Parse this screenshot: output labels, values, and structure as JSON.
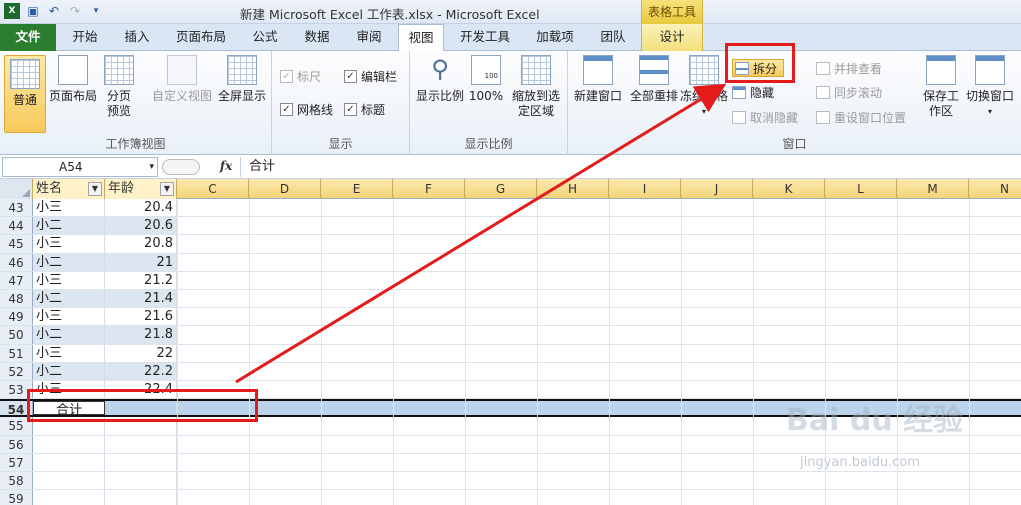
{
  "window": {
    "title": "新建 Microsoft Excel 工作表.xlsx - Microsoft Excel",
    "contextual_tab_group": "表格工具"
  },
  "tabs": [
    "文件",
    "开始",
    "插入",
    "页面布局",
    "公式",
    "数据",
    "审阅",
    "视图",
    "开发工具",
    "加载项",
    "团队",
    "设计"
  ],
  "ribbon": {
    "workbook_views": {
      "label": "工作簿视图",
      "normal": "普通",
      "page_layout": "页面布局",
      "page_break_preview": "分页预览",
      "custom_views": "自定义视图",
      "full_screen": "全屏显示"
    },
    "show": {
      "label": "显示",
      "ruler": "标尺",
      "formula_bar": "编辑栏",
      "gridlines": "网格线",
      "headings": "标题"
    },
    "zoom": {
      "label": "显示比例",
      "zoom": "显示比例",
      "hundred": "100%",
      "zoom_to_selection": "缩放到选定区域"
    },
    "window": {
      "label": "窗口",
      "new_window": "新建窗口",
      "arrange_all": "全部重排",
      "freeze_panes": "冻结窗格",
      "split": "拆分",
      "hide": "隐藏",
      "unhide": "取消隐藏",
      "view_side_by_side": "并排查看",
      "synchronous_scrolling": "同步滚动",
      "reset_window_position": "重设窗口位置",
      "save_workspace": "保存工作区",
      "switch_windows": "切换窗口"
    }
  },
  "formula_bar": {
    "name_box": "A54",
    "fx": "fx",
    "content": "合计"
  },
  "sheet": {
    "header_a": "姓名",
    "header_b": "年龄",
    "columns": [
      "C",
      "D",
      "E",
      "F",
      "G",
      "H",
      "I",
      "J",
      "K",
      "L",
      "M",
      "N"
    ],
    "rows": [
      {
        "n": "43",
        "a": "小三",
        "b": "20.4"
      },
      {
        "n": "44",
        "a": "小二",
        "b": "20.6"
      },
      {
        "n": "45",
        "a": "小三",
        "b": "20.8"
      },
      {
        "n": "46",
        "a": "小二",
        "b": "21"
      },
      {
        "n": "47",
        "a": "小三",
        "b": "21.2"
      },
      {
        "n": "48",
        "a": "小二",
        "b": "21.4"
      },
      {
        "n": "49",
        "a": "小三",
        "b": "21.6"
      },
      {
        "n": "50",
        "a": "小二",
        "b": "21.8"
      },
      {
        "n": "51",
        "a": "小三",
        "b": "22"
      },
      {
        "n": "52",
        "a": "小二",
        "b": "22.2"
      },
      {
        "n": "53",
        "a": "小三",
        "b": "22.4"
      },
      {
        "n": "54",
        "a": "合计",
        "b": ""
      },
      {
        "n": "55",
        "a": "",
        "b": ""
      },
      {
        "n": "56",
        "a": "",
        "b": ""
      },
      {
        "n": "57",
        "a": "",
        "b": ""
      },
      {
        "n": "58",
        "a": "",
        "b": ""
      },
      {
        "n": "59",
        "a": "",
        "b": ""
      }
    ]
  },
  "watermark": {
    "main": "Bai du 经验",
    "sub": "jingyan.baidu.com"
  },
  "colors": {
    "annotation": "#e31b1b",
    "file_tab": "#2b7d2f",
    "header": "#f4d478"
  }
}
